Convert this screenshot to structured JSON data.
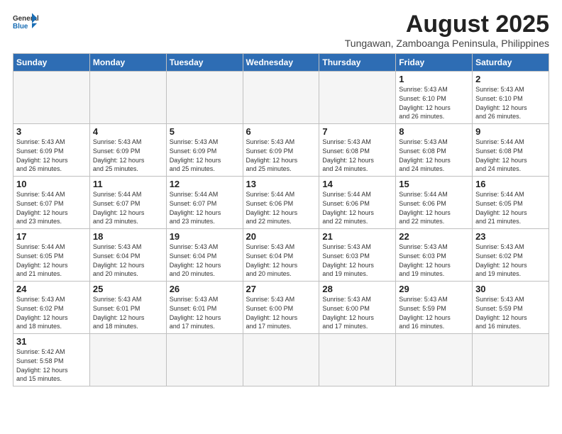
{
  "header": {
    "logo_general": "General",
    "logo_blue": "Blue",
    "main_title": "August 2025",
    "subtitle": "Tungawan, Zamboanga Peninsula, Philippines"
  },
  "weekdays": [
    "Sunday",
    "Monday",
    "Tuesday",
    "Wednesday",
    "Thursday",
    "Friday",
    "Saturday"
  ],
  "weeks": [
    [
      {
        "day": "",
        "info": ""
      },
      {
        "day": "",
        "info": ""
      },
      {
        "day": "",
        "info": ""
      },
      {
        "day": "",
        "info": ""
      },
      {
        "day": "",
        "info": ""
      },
      {
        "day": "1",
        "info": "Sunrise: 5:43 AM\nSunset: 6:10 PM\nDaylight: 12 hours\nand 26 minutes."
      },
      {
        "day": "2",
        "info": "Sunrise: 5:43 AM\nSunset: 6:10 PM\nDaylight: 12 hours\nand 26 minutes."
      }
    ],
    [
      {
        "day": "3",
        "info": "Sunrise: 5:43 AM\nSunset: 6:09 PM\nDaylight: 12 hours\nand 26 minutes."
      },
      {
        "day": "4",
        "info": "Sunrise: 5:43 AM\nSunset: 6:09 PM\nDaylight: 12 hours\nand 25 minutes."
      },
      {
        "day": "5",
        "info": "Sunrise: 5:43 AM\nSunset: 6:09 PM\nDaylight: 12 hours\nand 25 minutes."
      },
      {
        "day": "6",
        "info": "Sunrise: 5:43 AM\nSunset: 6:09 PM\nDaylight: 12 hours\nand 25 minutes."
      },
      {
        "day": "7",
        "info": "Sunrise: 5:43 AM\nSunset: 6:08 PM\nDaylight: 12 hours\nand 24 minutes."
      },
      {
        "day": "8",
        "info": "Sunrise: 5:43 AM\nSunset: 6:08 PM\nDaylight: 12 hours\nand 24 minutes."
      },
      {
        "day": "9",
        "info": "Sunrise: 5:44 AM\nSunset: 6:08 PM\nDaylight: 12 hours\nand 24 minutes."
      }
    ],
    [
      {
        "day": "10",
        "info": "Sunrise: 5:44 AM\nSunset: 6:07 PM\nDaylight: 12 hours\nand 23 minutes."
      },
      {
        "day": "11",
        "info": "Sunrise: 5:44 AM\nSunset: 6:07 PM\nDaylight: 12 hours\nand 23 minutes."
      },
      {
        "day": "12",
        "info": "Sunrise: 5:44 AM\nSunset: 6:07 PM\nDaylight: 12 hours\nand 23 minutes."
      },
      {
        "day": "13",
        "info": "Sunrise: 5:44 AM\nSunset: 6:06 PM\nDaylight: 12 hours\nand 22 minutes."
      },
      {
        "day": "14",
        "info": "Sunrise: 5:44 AM\nSunset: 6:06 PM\nDaylight: 12 hours\nand 22 minutes."
      },
      {
        "day": "15",
        "info": "Sunrise: 5:44 AM\nSunset: 6:06 PM\nDaylight: 12 hours\nand 22 minutes."
      },
      {
        "day": "16",
        "info": "Sunrise: 5:44 AM\nSunset: 6:05 PM\nDaylight: 12 hours\nand 21 minutes."
      }
    ],
    [
      {
        "day": "17",
        "info": "Sunrise: 5:44 AM\nSunset: 6:05 PM\nDaylight: 12 hours\nand 21 minutes."
      },
      {
        "day": "18",
        "info": "Sunrise: 5:43 AM\nSunset: 6:04 PM\nDaylight: 12 hours\nand 20 minutes."
      },
      {
        "day": "19",
        "info": "Sunrise: 5:43 AM\nSunset: 6:04 PM\nDaylight: 12 hours\nand 20 minutes."
      },
      {
        "day": "20",
        "info": "Sunrise: 5:43 AM\nSunset: 6:04 PM\nDaylight: 12 hours\nand 20 minutes."
      },
      {
        "day": "21",
        "info": "Sunrise: 5:43 AM\nSunset: 6:03 PM\nDaylight: 12 hours\nand 19 minutes."
      },
      {
        "day": "22",
        "info": "Sunrise: 5:43 AM\nSunset: 6:03 PM\nDaylight: 12 hours\nand 19 minutes."
      },
      {
        "day": "23",
        "info": "Sunrise: 5:43 AM\nSunset: 6:02 PM\nDaylight: 12 hours\nand 19 minutes."
      }
    ],
    [
      {
        "day": "24",
        "info": "Sunrise: 5:43 AM\nSunset: 6:02 PM\nDaylight: 12 hours\nand 18 minutes."
      },
      {
        "day": "25",
        "info": "Sunrise: 5:43 AM\nSunset: 6:01 PM\nDaylight: 12 hours\nand 18 minutes."
      },
      {
        "day": "26",
        "info": "Sunrise: 5:43 AM\nSunset: 6:01 PM\nDaylight: 12 hours\nand 17 minutes."
      },
      {
        "day": "27",
        "info": "Sunrise: 5:43 AM\nSunset: 6:00 PM\nDaylight: 12 hours\nand 17 minutes."
      },
      {
        "day": "28",
        "info": "Sunrise: 5:43 AM\nSunset: 6:00 PM\nDaylight: 12 hours\nand 17 minutes."
      },
      {
        "day": "29",
        "info": "Sunrise: 5:43 AM\nSunset: 5:59 PM\nDaylight: 12 hours\nand 16 minutes."
      },
      {
        "day": "30",
        "info": "Sunrise: 5:43 AM\nSunset: 5:59 PM\nDaylight: 12 hours\nand 16 minutes."
      }
    ],
    [
      {
        "day": "31",
        "info": "Sunrise: 5:42 AM\nSunset: 5:58 PM\nDaylight: 12 hours\nand 15 minutes."
      },
      {
        "day": "",
        "info": ""
      },
      {
        "day": "",
        "info": ""
      },
      {
        "day": "",
        "info": ""
      },
      {
        "day": "",
        "info": ""
      },
      {
        "day": "",
        "info": ""
      },
      {
        "day": "",
        "info": ""
      }
    ]
  ]
}
